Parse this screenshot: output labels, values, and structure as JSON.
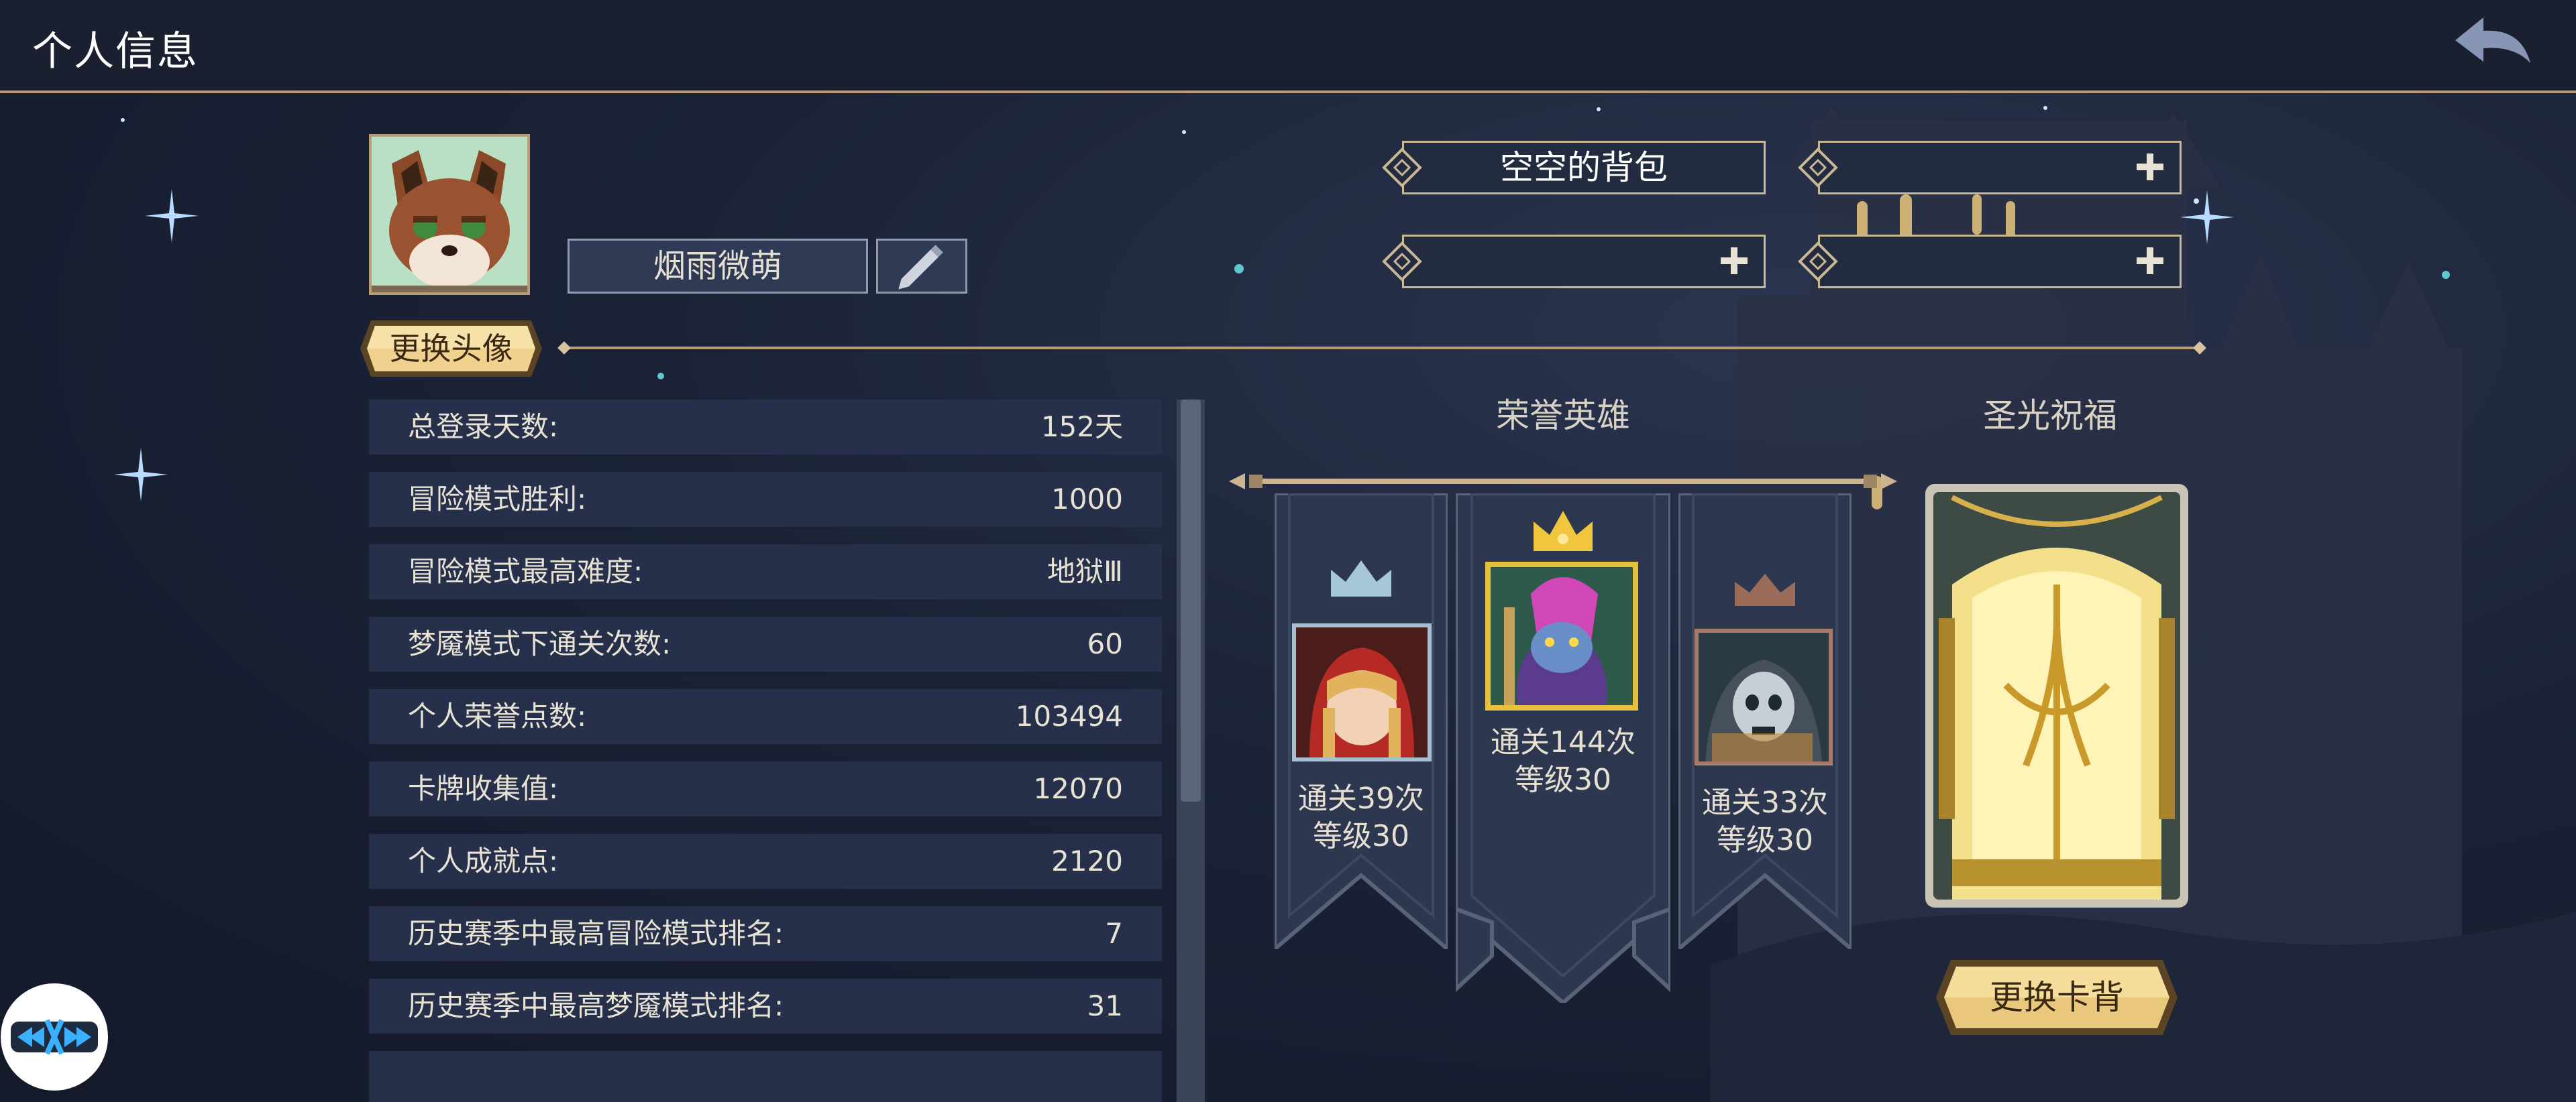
{
  "header": {
    "title": "个人信息",
    "back_icon": "back-arrow-icon"
  },
  "profile": {
    "avatar_icon": "fox-avatar-icon",
    "nickname": "烟雨微萌",
    "edit_icon": "pencil-icon",
    "change_avatar_label": "更换头像"
  },
  "slots": [
    {
      "text": "空空的背包",
      "icon": "diamond-icon"
    },
    {
      "text": "",
      "icon": "plus-icon"
    },
    {
      "text": "",
      "icon": "plus-icon"
    },
    {
      "text": "",
      "icon": "plus-icon"
    }
  ],
  "stats": [
    {
      "label": "总登录天数:",
      "value": "152天"
    },
    {
      "label": "冒险模式胜利:",
      "value": "1000"
    },
    {
      "label": "冒险模式最高难度:",
      "value": "地狱Ⅲ"
    },
    {
      "label": "梦魇模式下通关次数:",
      "value": "60"
    },
    {
      "label": "个人荣誉点数:",
      "value": "103494"
    },
    {
      "label": "卡牌收集值:",
      "value": "12070"
    },
    {
      "label": "个人成就点:",
      "value": "2120"
    },
    {
      "label": "历史赛季中最高冒险模式排名:",
      "value": "7"
    },
    {
      "label": "历史赛季中最高梦魇模式排名:",
      "value": "31"
    }
  ],
  "honor_heroes": {
    "title": "荣誉英雄",
    "heroes": [
      {
        "rank": "silver",
        "clears": "通关39次",
        "level": "等级30",
        "icon": "red-hood-hero-icon"
      },
      {
        "rank": "gold",
        "clears": "通关144次",
        "level": "等级30",
        "icon": "troll-hero-icon"
      },
      {
        "rank": "bronze",
        "clears": "通关33次",
        "level": "等级30",
        "icon": "undead-hero-icon"
      }
    ]
  },
  "holy_blessing": {
    "title": "圣光祝福",
    "change_card_label": "更换卡背"
  },
  "colors": {
    "accent_gold": "#e9c77d",
    "panel": "#27304a",
    "banner": "#2d3850",
    "divider": "#b89a73"
  }
}
